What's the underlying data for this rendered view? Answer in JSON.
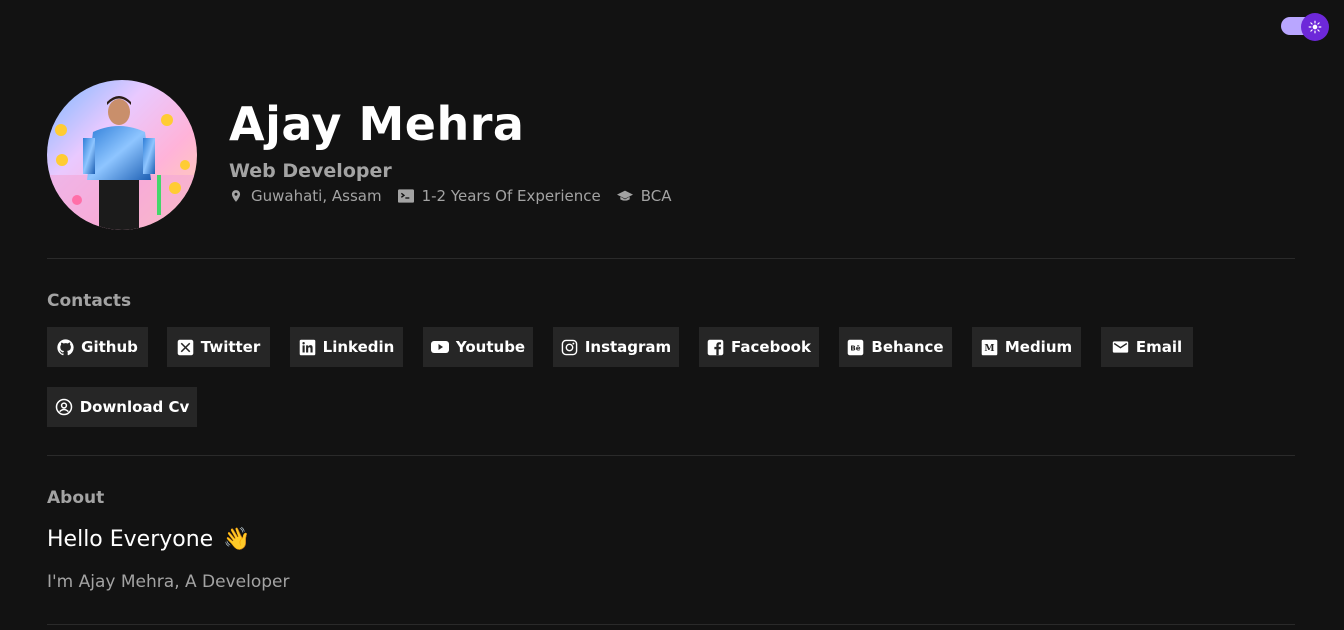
{
  "theme_toggle": {
    "icon": "sun-icon",
    "accent": "#6d28d9",
    "track": "#b9a6ff"
  },
  "profile": {
    "name": "Ajay Mehra",
    "role": "Web Developer",
    "location": "Guwahati, Assam",
    "experience": "1-2 Years Of Experience",
    "education": "BCA"
  },
  "contacts": {
    "title": "Contacts",
    "buttons": [
      {
        "label": "Github",
        "icon": "github-icon"
      },
      {
        "label": "Twitter",
        "icon": "x-twitter-icon"
      },
      {
        "label": "Linkedin",
        "icon": "linkedin-icon"
      },
      {
        "label": "Youtube",
        "icon": "youtube-icon"
      },
      {
        "label": "Instagram",
        "icon": "instagram-icon"
      },
      {
        "label": "Facebook",
        "icon": "facebook-icon"
      },
      {
        "label": "Behance",
        "icon": "behance-icon"
      },
      {
        "label": "Medium",
        "icon": "medium-icon"
      },
      {
        "label": "Email",
        "icon": "mail-icon"
      },
      {
        "label": "Download Cv",
        "icon": "user-circle-icon"
      }
    ]
  },
  "about": {
    "title": "About",
    "greeting": "Hello Everyone",
    "greeting_emoji": "👋",
    "intro": "I'm Ajay Mehra, A Developer"
  },
  "colors": {
    "background": "#121212",
    "button_bg": "#262626",
    "muted_text": "#a3a3a3"
  }
}
